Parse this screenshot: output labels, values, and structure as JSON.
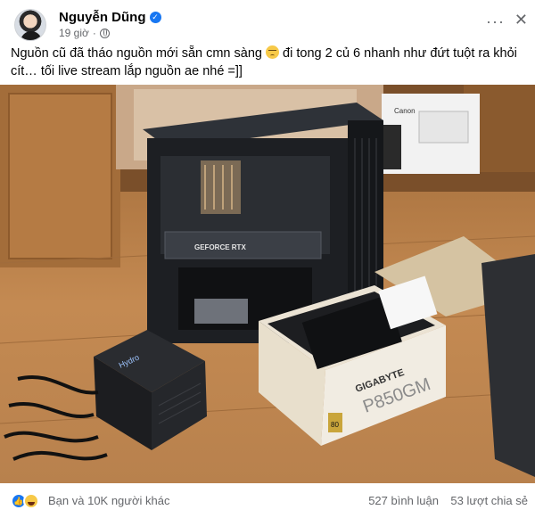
{
  "author": {
    "name": "Nguyễn Dũng",
    "verified_icon": "verified-badge-icon",
    "time": "19 giờ",
    "privacy_icon": "globe-icon"
  },
  "header_actions": {
    "more_icon": "more-options-icon",
    "close_icon": "close-icon"
  },
  "post": {
    "text_part1": "Nguồn cũ đã tháo nguồn mới sẵn cmn sàng",
    "text_part2": " đi tong 2 củ 6 nhanh như đứt tuột ra khỏi cít… tối live stream lắp nguồn ae nhé =]]",
    "emoji": "sad-face-emoji"
  },
  "photo": {
    "gpu_label": "GEFORCE RTX",
    "old_psu_label": "Hydro",
    "new_psu_brand": "GIGABYTE",
    "new_psu_model": "P850GM",
    "new_psu_badge": "80"
  },
  "footer": {
    "reactions_label": "Bạn và 10K người khác",
    "comments": "527 bình luận",
    "shares": "53 lượt chia sẻ"
  },
  "colors": {
    "accent": "#1877f2",
    "secondary_text": "#65676b"
  }
}
